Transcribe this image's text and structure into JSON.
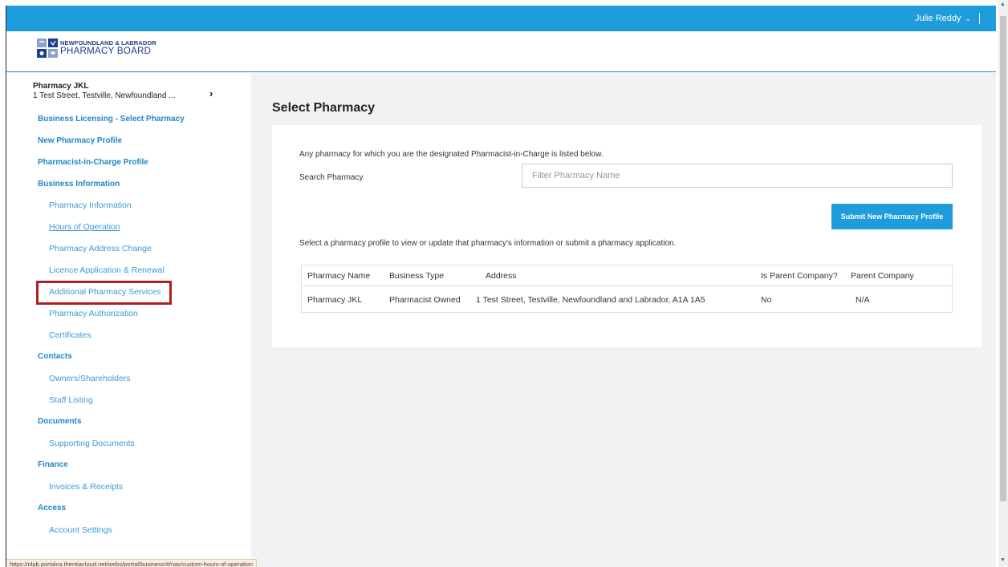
{
  "header": {
    "user_name": "Julie Reddy",
    "chevron": "⌄"
  },
  "logo": {
    "line1": "NEWFOUNDLAND & LABRADOR",
    "line2": "PHARMACY BOARD"
  },
  "sidebar": {
    "pharmacy_name": "Pharmacy JKL",
    "pharmacy_address": "1 Test Street, Testville, Newfoundland ...",
    "arrow": "›",
    "nav": [
      {
        "label": "Business Licensing - Select Pharmacy",
        "level": "top"
      },
      {
        "label": "New Pharmacy Profile",
        "level": "top"
      },
      {
        "label": "Pharmacist-in-Charge Profile",
        "level": "top"
      },
      {
        "label": "Business Information",
        "level": "top"
      },
      {
        "label": "Pharmacy Information",
        "level": "sub"
      },
      {
        "label": "Hours of Operation",
        "level": "sub",
        "active": true
      },
      {
        "label": "Pharmacy Address Change",
        "level": "sub"
      },
      {
        "label": "Licence Application & Renewal",
        "level": "sub"
      },
      {
        "label": "Additional Pharmacy Services",
        "level": "sub"
      },
      {
        "label": "Pharmacy Authorization",
        "level": "sub"
      },
      {
        "label": "Certificates",
        "level": "sub"
      },
      {
        "label": "Contacts",
        "level": "top"
      },
      {
        "label": "Owners/Shareholders",
        "level": "sub"
      },
      {
        "label": "Staff Listing",
        "level": "sub"
      },
      {
        "label": "Documents",
        "level": "top"
      },
      {
        "label": "Supporting Documents",
        "level": "sub"
      },
      {
        "label": "Finance",
        "level": "top"
      },
      {
        "label": "Invoices & Receipts",
        "level": "sub"
      },
      {
        "label": "Access",
        "level": "top"
      },
      {
        "label": "Account Settings",
        "level": "sub"
      }
    ]
  },
  "main": {
    "title": "Select Pharmacy",
    "intro": "Any pharmacy for which you are the designated Pharmacist-in-Charge is listed below.",
    "search_label": "Search Pharmacy",
    "search_placeholder": "Filter Pharmacy Name",
    "search_value": "",
    "submit_label": "Submit New Pharmacy Profile",
    "select_message": "Select a pharmacy profile to view or update that pharmacy's information or submit a pharmacy application.",
    "table": {
      "columns": [
        "Pharmacy Name",
        "Business Type",
        "Address",
        "Is Parent Company?",
        "Parent Company"
      ],
      "rows": [
        [
          "Pharmacy JKL",
          "Pharmacist Owned",
          "1 Test Street, Testville, Newfoundland and Labrador, A1A 1A5",
          "No",
          "N/A"
        ]
      ]
    }
  },
  "status_url": "https://nlpb.portalca.thentiacloud.net/webs/portal/business/#/nav/custom-hours-of-operation",
  "colors": {
    "accent": "#1e9cdc",
    "nav_link": "#1e87c8",
    "highlight": "#b01e23"
  }
}
